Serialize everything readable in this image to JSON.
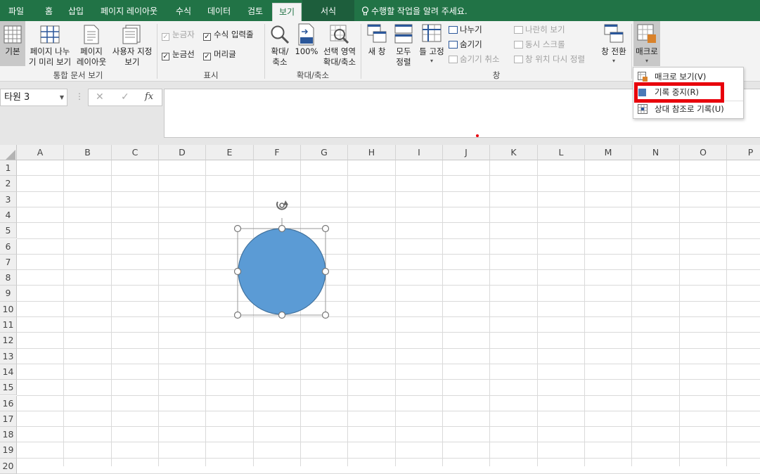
{
  "tabs": [
    "파일",
    "홈",
    "삽입",
    "페이지 레이아웃",
    "수식",
    "데이터",
    "검토",
    "보기",
    "서식"
  ],
  "active_tab": "보기",
  "tell_me": "수행할 작업을 알려 주세요.",
  "groups": {
    "workbook_views": {
      "label": "통합 문서 보기",
      "normal": "기본",
      "page_break_1": "페이지 나누",
      "page_break_2": "기 미리 보기",
      "page_layout_1": "페이지",
      "page_layout_2": "레이아웃",
      "custom_1": "사용자 지정",
      "custom_2": "보기"
    },
    "show": {
      "label": "표시",
      "ruler": "눈금자",
      "formula_bar": "수식 입력줄",
      "gridlines": "눈금선",
      "headings": "머리글"
    },
    "zoom": {
      "label": "확대/축소",
      "zoom_1": "확대/",
      "zoom_2": "축소",
      "z100": "100%",
      "sel_1": "선택 영역",
      "sel_2": "확대/축소"
    },
    "window": {
      "label": "창",
      "new_window": "새 창",
      "arrange_1": "모두",
      "arrange_2": "정렬",
      "freeze": "틀 고정",
      "split": "나누기",
      "hide": "숨기기",
      "unhide": "숨기기 취소",
      "side_by_side": "나란히 보기",
      "sync_scroll": "동시 스크롤",
      "reset_pos": "창 위치 다시 정렬",
      "switch": "창 전환"
    },
    "macros": {
      "label": "매크로"
    }
  },
  "name_box": "타원 3",
  "formula_icons": {
    "cancel": "✕",
    "enter": "✓",
    "fx": "fx"
  },
  "columns": [
    "A",
    "B",
    "C",
    "D",
    "E",
    "F",
    "G",
    "H",
    "I",
    "J",
    "K",
    "L",
    "M",
    "N",
    "O",
    "P"
  ],
  "rows": [
    "1",
    "2",
    "3",
    "4",
    "5",
    "6",
    "7",
    "8",
    "9",
    "10",
    "11",
    "12",
    "13",
    "14",
    "15",
    "16",
    "17",
    "18",
    "19",
    "20"
  ],
  "macro_menu": {
    "view": "매크로 보기(V)",
    "stop": "기록 중지(R)",
    "relative": "상대 참조로 기록(U)"
  },
  "colors": {
    "accent": "#217346",
    "shape_fill": "#5b9bd5",
    "shape_stroke": "#41719c",
    "highlight": "#e8000b"
  }
}
